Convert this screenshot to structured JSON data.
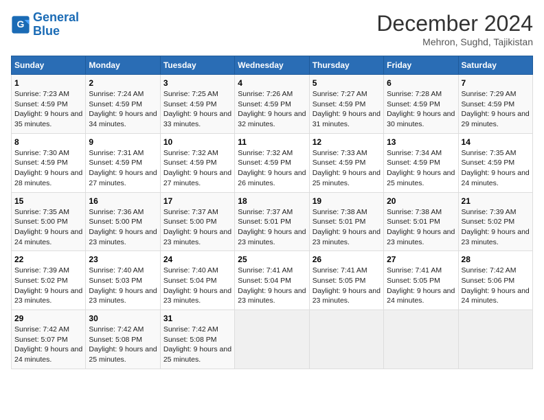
{
  "logo": {
    "line1": "General",
    "line2": "Blue"
  },
  "title": {
    "month_year": "December 2024",
    "location": "Mehron, Sughd, Tajikistan"
  },
  "weekdays": [
    "Sunday",
    "Monday",
    "Tuesday",
    "Wednesday",
    "Thursday",
    "Friday",
    "Saturday"
  ],
  "weeks": [
    [
      {
        "day": "1",
        "sunrise": "Sunrise: 7:23 AM",
        "sunset": "Sunset: 4:59 PM",
        "daylight": "Daylight: 9 hours and 35 minutes."
      },
      {
        "day": "2",
        "sunrise": "Sunrise: 7:24 AM",
        "sunset": "Sunset: 4:59 PM",
        "daylight": "Daylight: 9 hours and 34 minutes."
      },
      {
        "day": "3",
        "sunrise": "Sunrise: 7:25 AM",
        "sunset": "Sunset: 4:59 PM",
        "daylight": "Daylight: 9 hours and 33 minutes."
      },
      {
        "day": "4",
        "sunrise": "Sunrise: 7:26 AM",
        "sunset": "Sunset: 4:59 PM",
        "daylight": "Daylight: 9 hours and 32 minutes."
      },
      {
        "day": "5",
        "sunrise": "Sunrise: 7:27 AM",
        "sunset": "Sunset: 4:59 PM",
        "daylight": "Daylight: 9 hours and 31 minutes."
      },
      {
        "day": "6",
        "sunrise": "Sunrise: 7:28 AM",
        "sunset": "Sunset: 4:59 PM",
        "daylight": "Daylight: 9 hours and 30 minutes."
      },
      {
        "day": "7",
        "sunrise": "Sunrise: 7:29 AM",
        "sunset": "Sunset: 4:59 PM",
        "daylight": "Daylight: 9 hours and 29 minutes."
      }
    ],
    [
      {
        "day": "8",
        "sunrise": "Sunrise: 7:30 AM",
        "sunset": "Sunset: 4:59 PM",
        "daylight": "Daylight: 9 hours and 28 minutes."
      },
      {
        "day": "9",
        "sunrise": "Sunrise: 7:31 AM",
        "sunset": "Sunset: 4:59 PM",
        "daylight": "Daylight: 9 hours and 27 minutes."
      },
      {
        "day": "10",
        "sunrise": "Sunrise: 7:32 AM",
        "sunset": "Sunset: 4:59 PM",
        "daylight": "Daylight: 9 hours and 27 minutes."
      },
      {
        "day": "11",
        "sunrise": "Sunrise: 7:32 AM",
        "sunset": "Sunset: 4:59 PM",
        "daylight": "Daylight: 9 hours and 26 minutes."
      },
      {
        "day": "12",
        "sunrise": "Sunrise: 7:33 AM",
        "sunset": "Sunset: 4:59 PM",
        "daylight": "Daylight: 9 hours and 25 minutes."
      },
      {
        "day": "13",
        "sunrise": "Sunrise: 7:34 AM",
        "sunset": "Sunset: 4:59 PM",
        "daylight": "Daylight: 9 hours and 25 minutes."
      },
      {
        "day": "14",
        "sunrise": "Sunrise: 7:35 AM",
        "sunset": "Sunset: 4:59 PM",
        "daylight": "Daylight: 9 hours and 24 minutes."
      }
    ],
    [
      {
        "day": "15",
        "sunrise": "Sunrise: 7:35 AM",
        "sunset": "Sunset: 5:00 PM",
        "daylight": "Daylight: 9 hours and 24 minutes."
      },
      {
        "day": "16",
        "sunrise": "Sunrise: 7:36 AM",
        "sunset": "Sunset: 5:00 PM",
        "daylight": "Daylight: 9 hours and 23 minutes."
      },
      {
        "day": "17",
        "sunrise": "Sunrise: 7:37 AM",
        "sunset": "Sunset: 5:00 PM",
        "daylight": "Daylight: 9 hours and 23 minutes."
      },
      {
        "day": "18",
        "sunrise": "Sunrise: 7:37 AM",
        "sunset": "Sunset: 5:01 PM",
        "daylight": "Daylight: 9 hours and 23 minutes."
      },
      {
        "day": "19",
        "sunrise": "Sunrise: 7:38 AM",
        "sunset": "Sunset: 5:01 PM",
        "daylight": "Daylight: 9 hours and 23 minutes."
      },
      {
        "day": "20",
        "sunrise": "Sunrise: 7:38 AM",
        "sunset": "Sunset: 5:01 PM",
        "daylight": "Daylight: 9 hours and 23 minutes."
      },
      {
        "day": "21",
        "sunrise": "Sunrise: 7:39 AM",
        "sunset": "Sunset: 5:02 PM",
        "daylight": "Daylight: 9 hours and 23 minutes."
      }
    ],
    [
      {
        "day": "22",
        "sunrise": "Sunrise: 7:39 AM",
        "sunset": "Sunset: 5:02 PM",
        "daylight": "Daylight: 9 hours and 23 minutes."
      },
      {
        "day": "23",
        "sunrise": "Sunrise: 7:40 AM",
        "sunset": "Sunset: 5:03 PM",
        "daylight": "Daylight: 9 hours and 23 minutes."
      },
      {
        "day": "24",
        "sunrise": "Sunrise: 7:40 AM",
        "sunset": "Sunset: 5:04 PM",
        "daylight": "Daylight: 9 hours and 23 minutes."
      },
      {
        "day": "25",
        "sunrise": "Sunrise: 7:41 AM",
        "sunset": "Sunset: 5:04 PM",
        "daylight": "Daylight: 9 hours and 23 minutes."
      },
      {
        "day": "26",
        "sunrise": "Sunrise: 7:41 AM",
        "sunset": "Sunset: 5:05 PM",
        "daylight": "Daylight: 9 hours and 23 minutes."
      },
      {
        "day": "27",
        "sunrise": "Sunrise: 7:41 AM",
        "sunset": "Sunset: 5:05 PM",
        "daylight": "Daylight: 9 hours and 24 minutes."
      },
      {
        "day": "28",
        "sunrise": "Sunrise: 7:42 AM",
        "sunset": "Sunset: 5:06 PM",
        "daylight": "Daylight: 9 hours and 24 minutes."
      }
    ],
    [
      {
        "day": "29",
        "sunrise": "Sunrise: 7:42 AM",
        "sunset": "Sunset: 5:07 PM",
        "daylight": "Daylight: 9 hours and 24 minutes."
      },
      {
        "day": "30",
        "sunrise": "Sunrise: 7:42 AM",
        "sunset": "Sunset: 5:08 PM",
        "daylight": "Daylight: 9 hours and 25 minutes."
      },
      {
        "day": "31",
        "sunrise": "Sunrise: 7:42 AM",
        "sunset": "Sunset: 5:08 PM",
        "daylight": "Daylight: 9 hours and 25 minutes."
      },
      null,
      null,
      null,
      null
    ]
  ]
}
